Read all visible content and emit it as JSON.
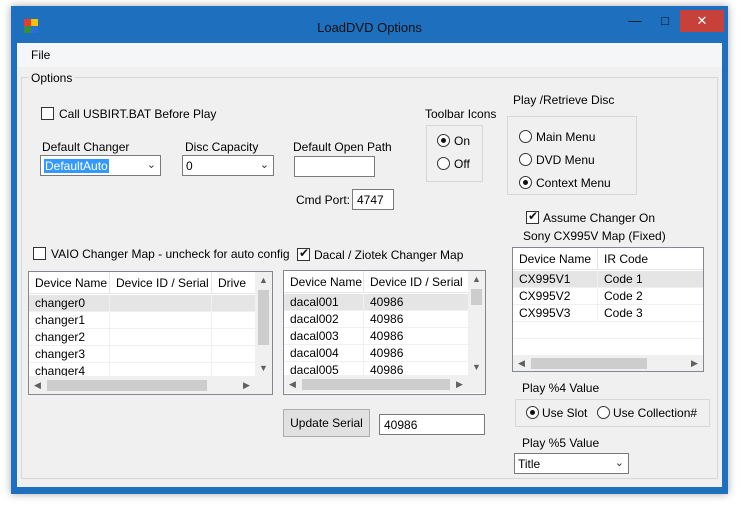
{
  "window": {
    "title": "LoadDVD Options"
  },
  "menu": {
    "file": "File"
  },
  "options_group": {
    "label": "Options"
  },
  "usbirt": {
    "label": "Call USBIRT.BAT Before Play",
    "checked": false
  },
  "default_changer": {
    "label": "Default Changer",
    "value": "DefaultAuto"
  },
  "disc_capacity": {
    "label": "Disc Capacity",
    "value": "0"
  },
  "default_open_path": {
    "label": "Default Open Path",
    "value": ""
  },
  "cmd_port": {
    "label": "Cmd Port:",
    "value": "4747"
  },
  "toolbar_icons": {
    "label": "Toolbar Icons",
    "on": "On",
    "off": "Off",
    "selected": "On"
  },
  "play_retrieve": {
    "label": "Play /Retrieve Disc",
    "options": [
      "Main Menu",
      "DVD Menu",
      "Context Menu"
    ],
    "selected": "Context Menu"
  },
  "assume_changer": {
    "label": "Assume Changer On",
    "checked": true
  },
  "sony_map": {
    "label": "Sony CX995V Map (Fixed)",
    "columns": [
      "Device Name",
      "IR Code"
    ],
    "rows": [
      [
        "CX995V1",
        "Code 1"
      ],
      [
        "CX995V2",
        "Code 2"
      ],
      [
        "CX995V3",
        "Code 3"
      ]
    ]
  },
  "vaio_map": {
    "label": "VAIO Changer Map - uncheck for auto config",
    "checked": false,
    "columns": [
      "Device Name",
      "Device ID / Serial",
      "Drive"
    ],
    "rows": [
      [
        "changer0",
        "",
        ""
      ],
      [
        "changer1",
        "",
        ""
      ],
      [
        "changer2",
        "",
        ""
      ],
      [
        "changer3",
        "",
        ""
      ],
      [
        "changer4",
        "",
        ""
      ]
    ]
  },
  "dacal_map": {
    "label": "Dacal / Ziotek Changer Map",
    "checked": true,
    "columns": [
      "Device Name",
      "Device ID / Serial"
    ],
    "rows": [
      [
        "dacal001",
        "40986"
      ],
      [
        "dacal002",
        "40986"
      ],
      [
        "dacal003",
        "40986"
      ],
      [
        "dacal004",
        "40986"
      ],
      [
        "dacal005",
        "40986"
      ]
    ]
  },
  "update_serial": {
    "label": "Update Serial",
    "value": "40986"
  },
  "play4": {
    "label": "Play %4 Value",
    "use_slot": "Use Slot",
    "use_collection": "Use Collection#",
    "selected": "Use Slot"
  },
  "play5": {
    "label": "Play %5 Value",
    "value": "Title"
  },
  "colors": {
    "titlebar": "#1e6fbd",
    "close": "#c7403a",
    "selection": "#3399ff"
  }
}
